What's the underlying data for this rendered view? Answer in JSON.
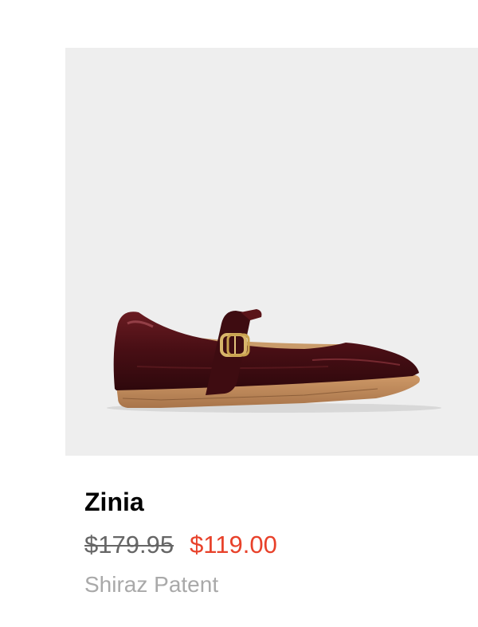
{
  "product": {
    "name": "Zinia",
    "original_price": "$179.95",
    "sale_price": "$119.00",
    "color_name": "Shiraz Patent",
    "image_icon": "mary-jane-shoe-image"
  },
  "colors": {
    "image_background": "#eeeeee",
    "sale_price": "#e8412a",
    "original_price": "#666666",
    "color_name": "#a9a9a9",
    "shoe_upper": "#4a1015",
    "sole": "#c08a5a"
  }
}
